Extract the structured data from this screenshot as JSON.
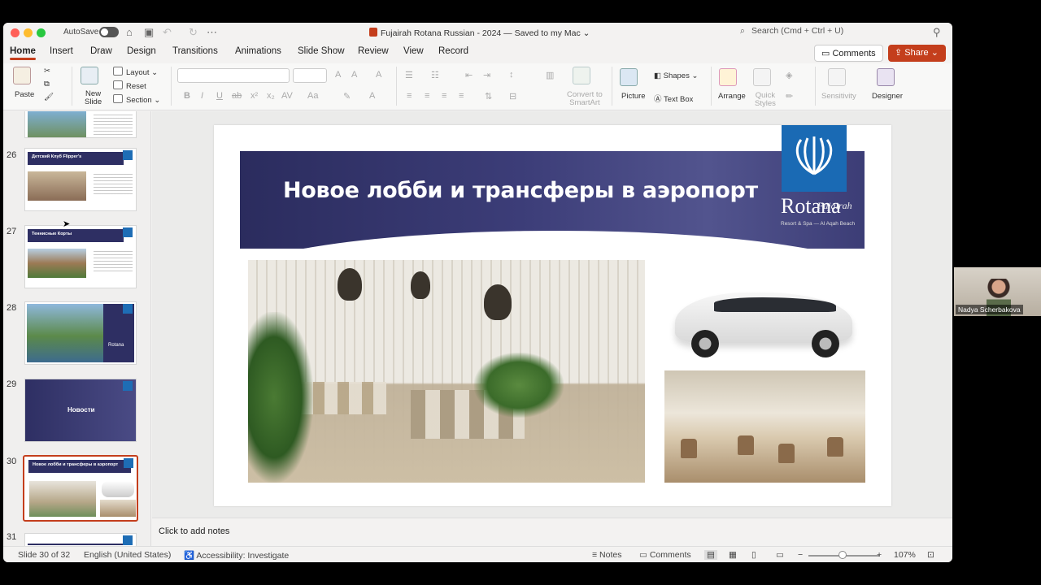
{
  "window": {
    "autosave_label": "AutoSave",
    "doc_title": "Fujairah Rotana Russian - 2024 — Saved to my Mac ⌄",
    "search_placeholder": "Search (Cmd + Ctrl + U)"
  },
  "tabs": [
    "Home",
    "Insert",
    "Draw",
    "Design",
    "Transitions",
    "Animations",
    "Slide Show",
    "Review",
    "View",
    "Record"
  ],
  "buttons": {
    "comments": "Comments",
    "share": "Share"
  },
  "ribbon": {
    "paste": "Paste",
    "new_slide": "New\nSlide",
    "layout": "Layout",
    "reset": "Reset",
    "section": "Section",
    "convert_smartart": "Convert to\nSmartArt",
    "picture": "Picture",
    "shapes": "Shapes",
    "text_box": "Text Box",
    "arrange": "Arrange",
    "quick_styles": "Quick\nStyles",
    "sensitivity": "Sensitivity",
    "designer": "Designer"
  },
  "thumbnails": [
    {
      "num": "26",
      "title": "Детский Клуб Flipper's"
    },
    {
      "num": "27",
      "title": "Теннисные Корты"
    },
    {
      "num": "28",
      "title": ""
    },
    {
      "num": "29",
      "title": "Новости"
    },
    {
      "num": "30",
      "title": "Новое лобби и трансферы в аэропорт"
    },
    {
      "num": "31",
      "title": ""
    }
  ],
  "slide": {
    "title": "Новое лобби и трансферы в аэропорт",
    "logo_line1": "Fujairah",
    "logo_line2": "Rotana",
    "logo_line3": "Resort & Spa — Al Aqah Beach"
  },
  "notes_placeholder": "Click to add notes",
  "status": {
    "slide_counter": "Slide 30 of 32",
    "language": "English (United States)",
    "accessibility": "Accessibility: Investigate",
    "notes": "Notes",
    "comments": "Comments",
    "zoom": "107%"
  },
  "video": {
    "participant": "Nadya Scherbakova"
  },
  "colors": {
    "accent": "#c43e1c",
    "banner": "#2e2f63",
    "logo_blue": "#1a6ab4"
  }
}
